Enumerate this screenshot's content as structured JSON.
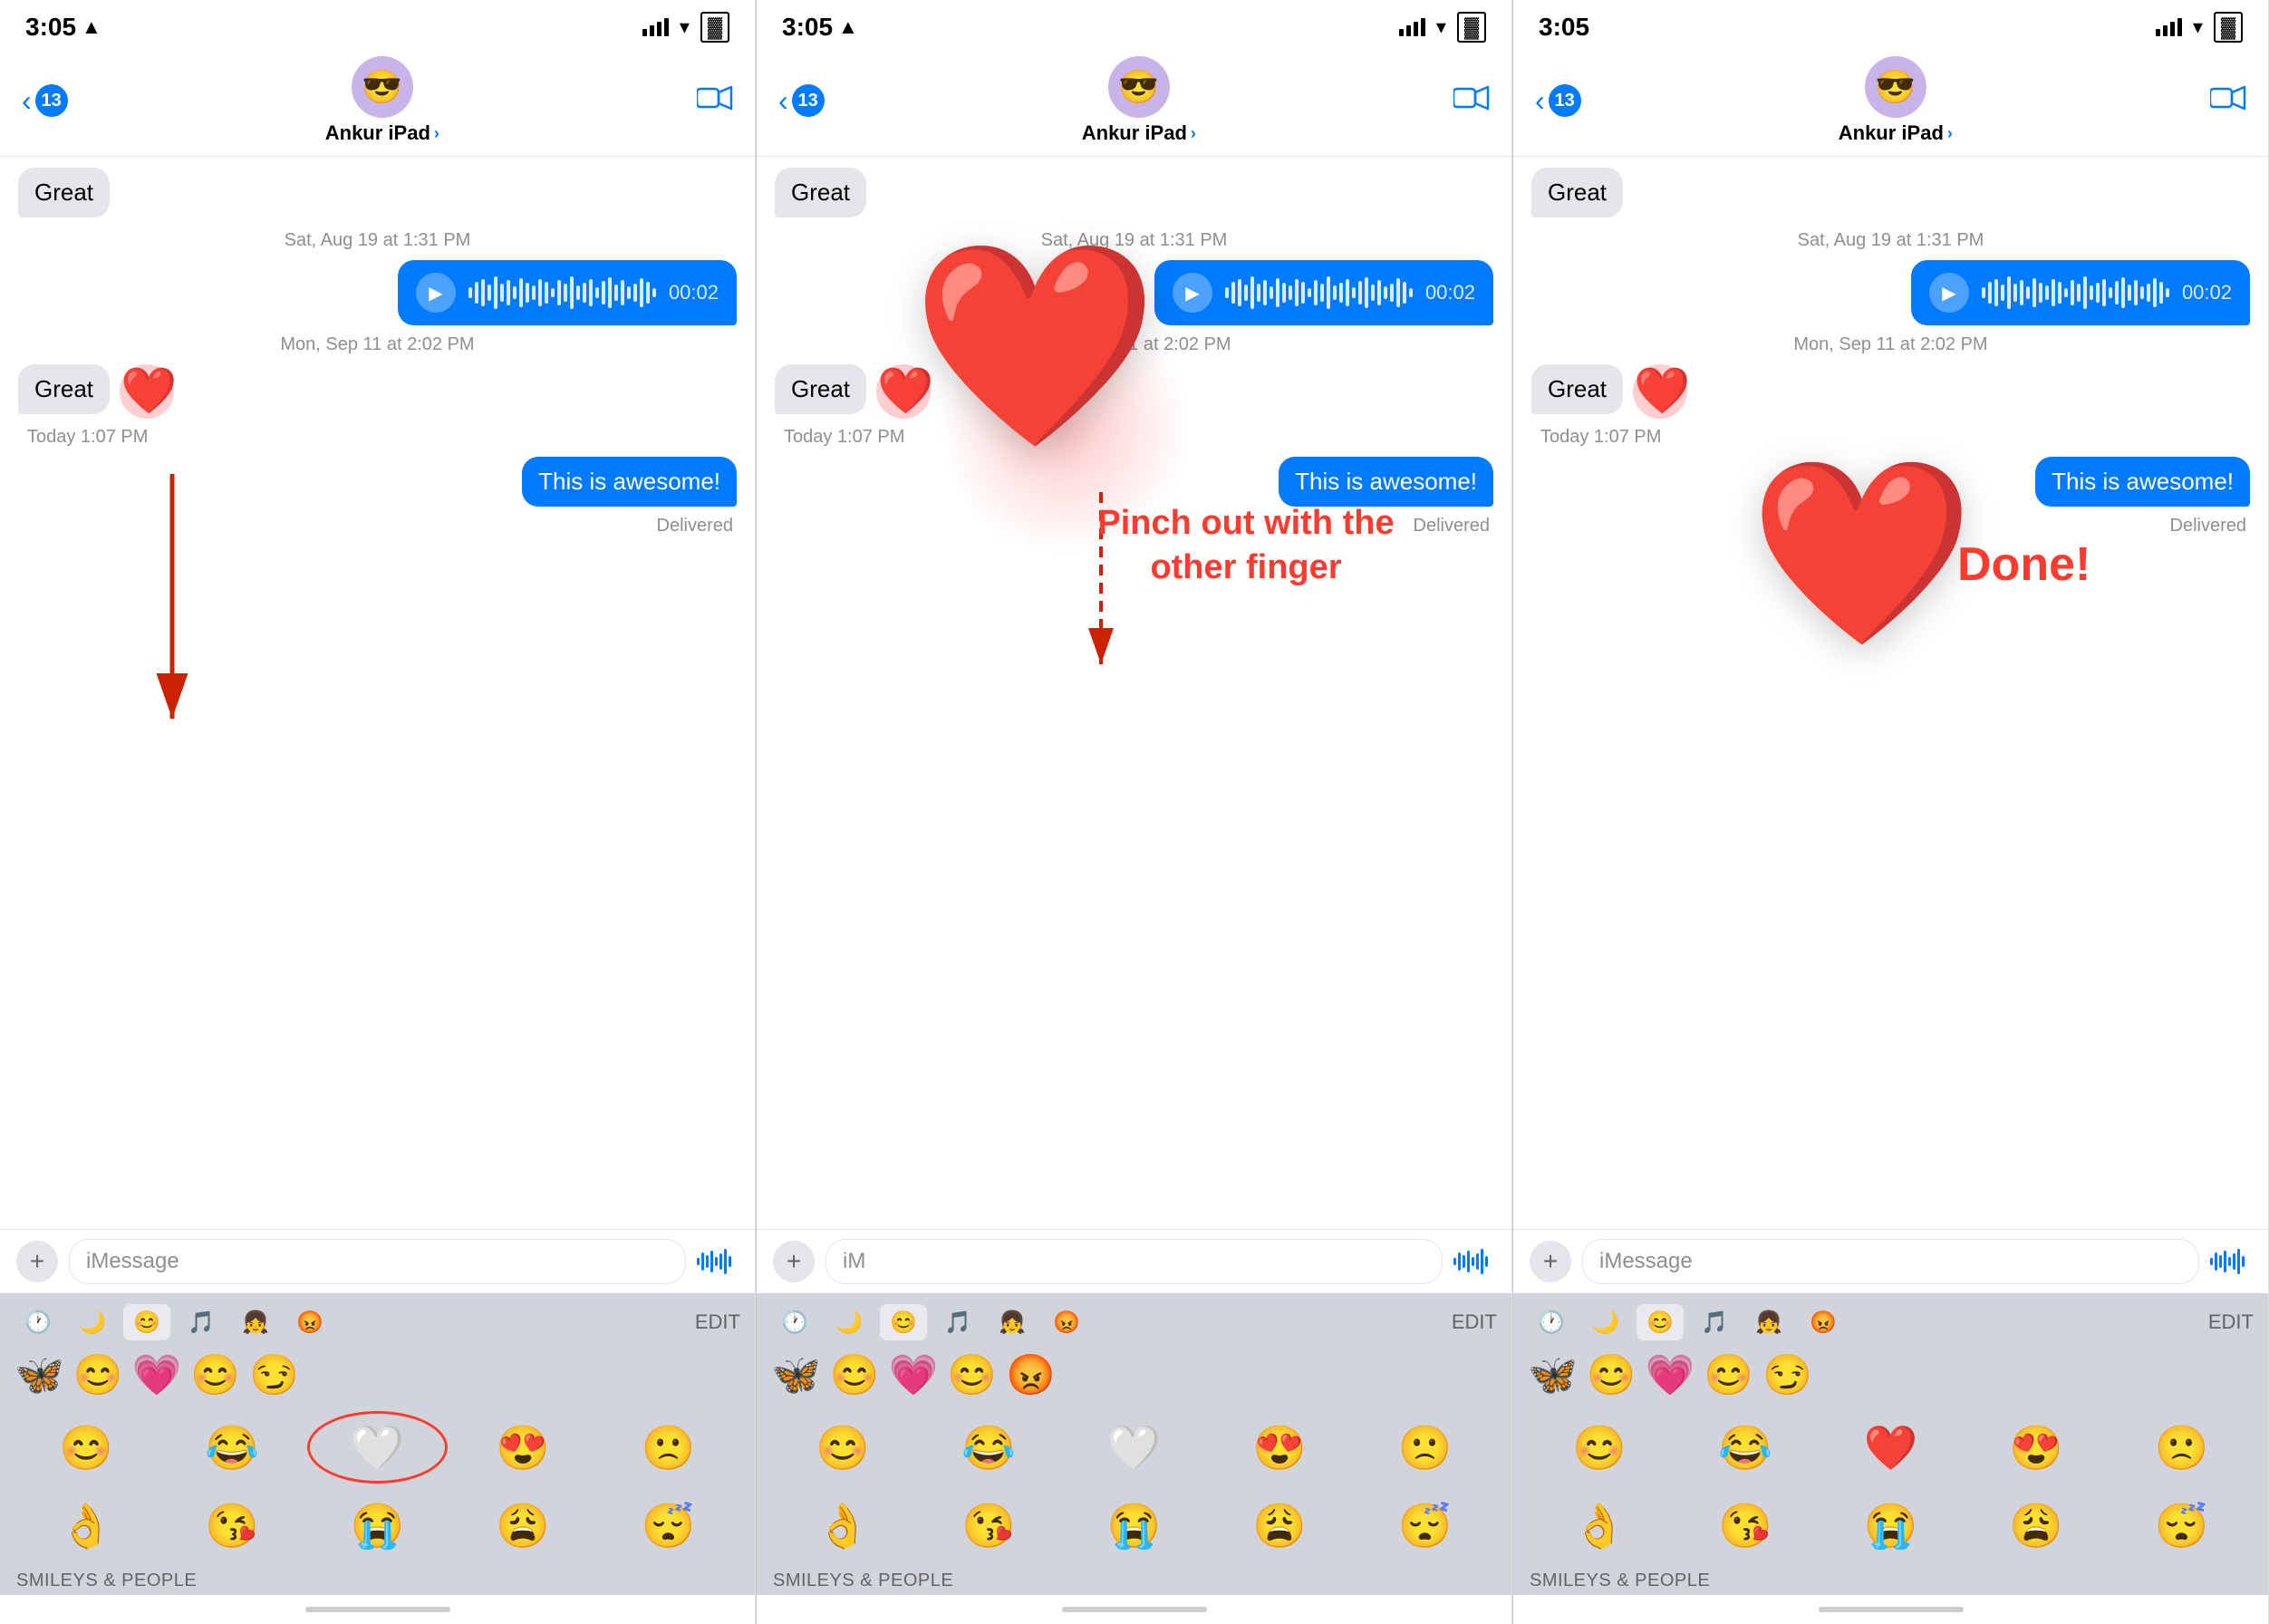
{
  "panels": [
    {
      "id": "panel1",
      "statusBar": {
        "time": "3:05",
        "hasLocation": true
      },
      "nav": {
        "backCount": "13",
        "contactName": "Ankur iPad",
        "avatar": "😎"
      },
      "messages": {
        "topBubble": "Great",
        "timestamp1": "Sat, Aug 19 at 1:31 PM",
        "voiceDuration": "00:02",
        "timestamp2": "Mon, Sep 11 at 2:02 PM",
        "receivedMsg": "Great",
        "tapbackHeart": "❤️",
        "timestamp3": "Today 1:07 PM",
        "sentMsg": "This is awesome!",
        "delivered": "Delivered"
      },
      "inputPlaceholder": "iMessage",
      "emojiTabs": [
        "🕐",
        "🌙",
        "😊",
        "🎵",
        "👧",
        "😡"
      ],
      "editLabel": "EDIT",
      "recentEmojis": [
        "🦋",
        "😊",
        "💗",
        "😊",
        "😏"
      ],
      "emojiGrid": [
        [
          "😊",
          "😂",
          "🤍",
          "😍",
          "🙁"
        ],
        [
          "👌",
          "😘",
          "😭",
          "😩",
          "😴"
        ]
      ],
      "sectionLabel": "SMILEYS & PEOPLE",
      "selectedEmoji": "🤍"
    },
    {
      "id": "panel2",
      "statusBar": {
        "time": "3:05",
        "hasLocation": true
      },
      "nav": {
        "backCount": "13",
        "contactName": "Ankur iPad",
        "avatar": "😎"
      },
      "messages": {
        "topBubble": "Great",
        "timestamp1": "Sat, Aug 19 at 1:31 PM",
        "voiceDuration": "00:02",
        "timestamp2": "Mon, Sep 11 at 2:02 PM",
        "receivedMsg": "Great",
        "tapbackHeart": "❤️",
        "timestamp3": "Today 1:07 PM",
        "sentMsg": "This is awesome!",
        "delivered": "Delivered"
      },
      "inputPlaceholder": "iM",
      "pinchText": "Pinch out with\nthe other finger",
      "emojiTabs": [
        "🕐",
        "🌙",
        "😊",
        "🎵",
        "👧",
        "😡"
      ],
      "editLabel": "EDIT",
      "recentEmojis": [
        "🦋",
        "😊",
        "💗",
        "😊",
        "😡"
      ],
      "emojiGrid": [
        [
          "😊",
          "😂",
          "🤍",
          "😍",
          "🙁"
        ],
        [
          "👌",
          "😘",
          "😭",
          "😩",
          "😴"
        ]
      ],
      "sectionLabel": "SMILEYS & PEOPLE"
    },
    {
      "id": "panel3",
      "statusBar": {
        "time": "3:05",
        "hasLocation": false
      },
      "nav": {
        "backCount": "13",
        "contactName": "Ankur iPad",
        "avatar": "😎"
      },
      "messages": {
        "topBubble": "Great",
        "timestamp1": "Sat, Aug 19 at 1:31 PM",
        "voiceDuration": "00:02",
        "timestamp2": "Mon, Sep 11 at 2:02 PM",
        "receivedMsg": "Great",
        "tapbackHeart": "❤️",
        "timestamp3": "Today 1:07 PM",
        "sentMsg": "This is awesome!",
        "delivered": "Delivered"
      },
      "inputPlaceholder": "iMessage",
      "doneText": "Done!",
      "emojiTabs": [
        "🕐",
        "🌙",
        "😊",
        "🎵",
        "👧",
        "😡"
      ],
      "editLabel": "EDIT",
      "recentEmojis": [
        "🦋",
        "😊",
        "💗",
        "😊",
        "😏"
      ],
      "emojiGrid": [
        [
          "😊",
          "😂",
          "❤️",
          "😍",
          "🙁"
        ],
        [
          "👌",
          "😘",
          "😭",
          "😩",
          "😴"
        ]
      ],
      "sectionLabel": "SMILEYS & PEOPLE"
    }
  ]
}
